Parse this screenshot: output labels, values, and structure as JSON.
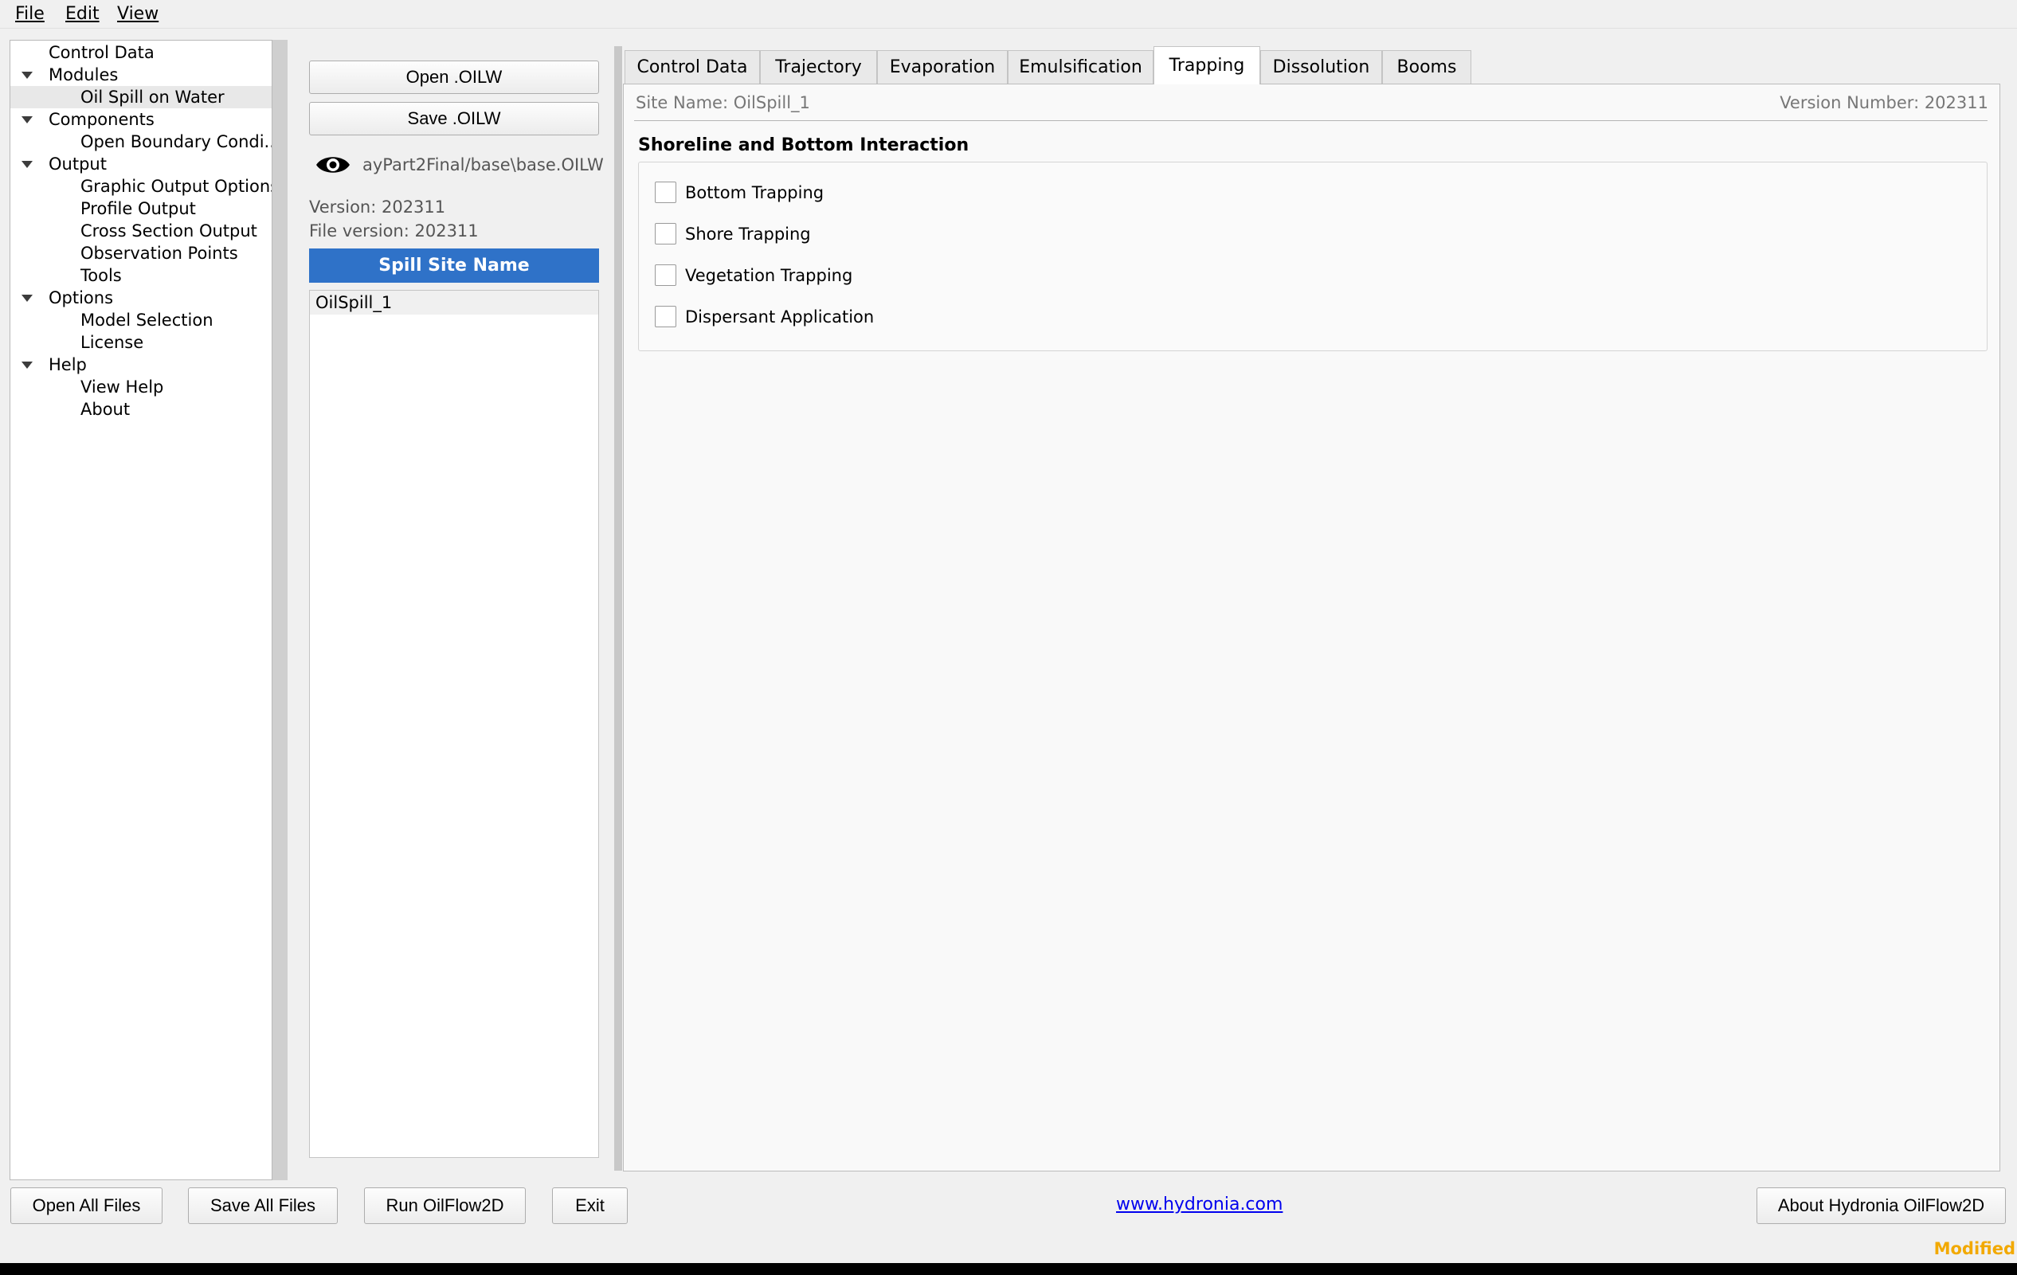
{
  "menubar": {
    "file": "File",
    "edit": "Edit",
    "view": "View"
  },
  "tree": [
    {
      "label": "Control Data",
      "level": 0,
      "expanded": false
    },
    {
      "label": "Modules",
      "level": 0,
      "expanded": true
    },
    {
      "label": "Oil Spill on Water",
      "level": 1,
      "selected": true
    },
    {
      "label": "Components",
      "level": 0,
      "expanded": true
    },
    {
      "label": "Open Boundary Condi...",
      "level": 1
    },
    {
      "label": "Output",
      "level": 0,
      "expanded": true
    },
    {
      "label": "Graphic Output Options",
      "level": 1
    },
    {
      "label": "Profile Output",
      "level": 1
    },
    {
      "label": "Cross Section Output",
      "level": 1
    },
    {
      "label": "Observation Points",
      "level": 1
    },
    {
      "label": "Tools",
      "level": 1
    },
    {
      "label": "Options",
      "level": 0,
      "expanded": true
    },
    {
      "label": "Model Selection",
      "level": 1
    },
    {
      "label": "License",
      "level": 1
    },
    {
      "label": "Help",
      "level": 0,
      "expanded": true
    },
    {
      "label": "View Help",
      "level": 1
    },
    {
      "label": "About",
      "level": 1
    }
  ],
  "file_panel": {
    "open_label": "Open .OILW",
    "save_label": "Save .OILW",
    "eye_icon": "eye-icon",
    "file_path": "ayPart2Final/base\\base.OILW",
    "version": "Version: 202311",
    "file_version": "File version: 202311",
    "list_header": "Spill Site Name",
    "sites": [
      "OilSpill_1"
    ]
  },
  "tabs": [
    {
      "label": "Control Data",
      "active": false
    },
    {
      "label": "Trajectory",
      "active": false
    },
    {
      "label": "Evaporation",
      "active": false
    },
    {
      "label": "Emulsification",
      "active": false
    },
    {
      "label": "Trapping",
      "active": true
    },
    {
      "label": "Dissolution",
      "active": false
    },
    {
      "label": "Booms",
      "active": false
    }
  ],
  "content": {
    "site_name": "Site Name: OilSpill_1",
    "version_number": "Version Number: 202311",
    "section_title": "Shoreline and Bottom Interaction",
    "options": [
      {
        "label": "Bottom Trapping",
        "checked": false
      },
      {
        "label": "Shore Trapping",
        "checked": false
      },
      {
        "label": "Vegetation Trapping",
        "checked": false
      },
      {
        "label": "Dispersant Application",
        "checked": false
      }
    ]
  },
  "footer": {
    "open_all": "Open All Files",
    "save_all": "Save All Files",
    "run": "Run OilFlow2D",
    "exit": "Exit",
    "link": "www.hydronia.com",
    "about": "About Hydronia OilFlow2D",
    "status": "Modified"
  },
  "colors": {
    "accent": "#2f72c8",
    "status": "#f2a900",
    "link": "#0000ee"
  }
}
